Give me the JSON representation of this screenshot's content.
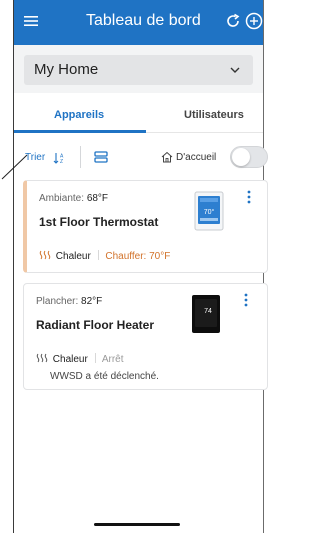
{
  "appbar": {
    "title": "Tableau de bord",
    "menu_icon": "hamburger-menu-icon",
    "refresh_icon": "refresh-icon",
    "add_icon": "add-circle-icon",
    "color": "#1f73c4"
  },
  "home_select": {
    "value": "My Home",
    "icon": "chevron-down-icon"
  },
  "tabs": [
    {
      "label": "Appareils",
      "active": true
    },
    {
      "label": "Utilisateurs",
      "active": false
    }
  ],
  "toolbar": {
    "sort_label": "Trier",
    "sort_icon": "sort-az-icon",
    "view_icon": "list-view-icon",
    "home_label": "D'accueil",
    "home_icon": "home-icon",
    "home_toggle_on": false
  },
  "devices": [
    {
      "temp_label": "Ambiante:",
      "temp_value": "68°F",
      "name": "1st Floor Thermostat",
      "mode": "Chaleur",
      "status": "Chauffer: 70°F",
      "status_color": "#d2732b",
      "display_value": "70°",
      "accent": "#f0c8a6"
    },
    {
      "temp_label": "Plancher:",
      "temp_value": "82°F",
      "name": "Radiant Floor Heater",
      "mode": "Chaleur",
      "status": "Arrêt",
      "note": "WWSD a été déclenché.",
      "display_value": "74"
    }
  ]
}
